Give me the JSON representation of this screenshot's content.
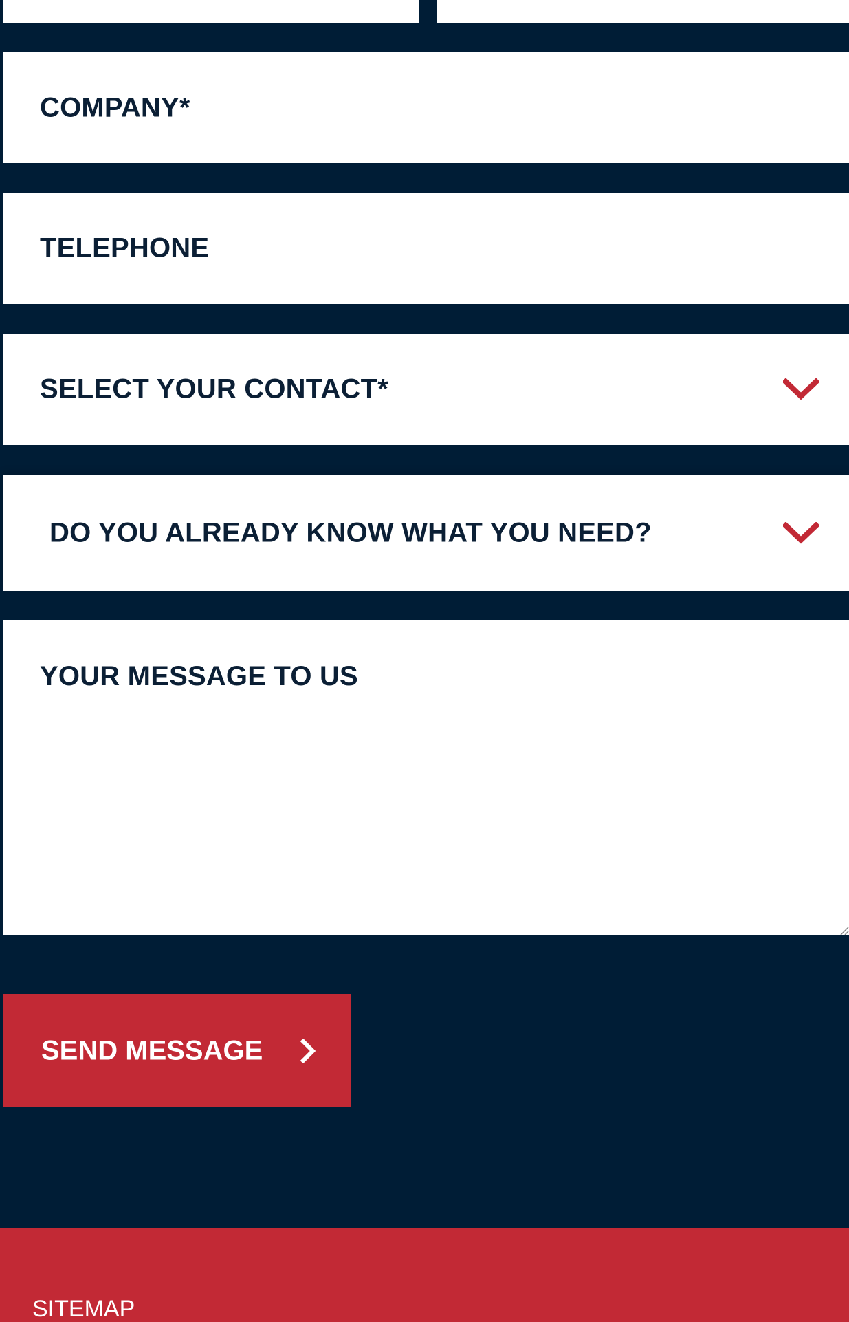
{
  "form": {
    "company_label": "COMPANY*",
    "telephone_label": "TELEPHONE",
    "contact_select_label": "SELECT YOUR CONTACT*",
    "need_select_label": "DO YOU ALREADY KNOW WHAT YOU NEED?",
    "message_label": "YOUR MESSAGE TO US",
    "submit_label": "SEND MESSAGE"
  },
  "footer": {
    "sitemap_label": "SITEMAP"
  },
  "colors": {
    "background": "#001d36",
    "field": "#ffffff",
    "accent": "#c22935",
    "text": "#0b1f35"
  },
  "icons": {
    "select_chevron": "chevron-down-icon",
    "button_arrow": "chevron-right-icon"
  }
}
